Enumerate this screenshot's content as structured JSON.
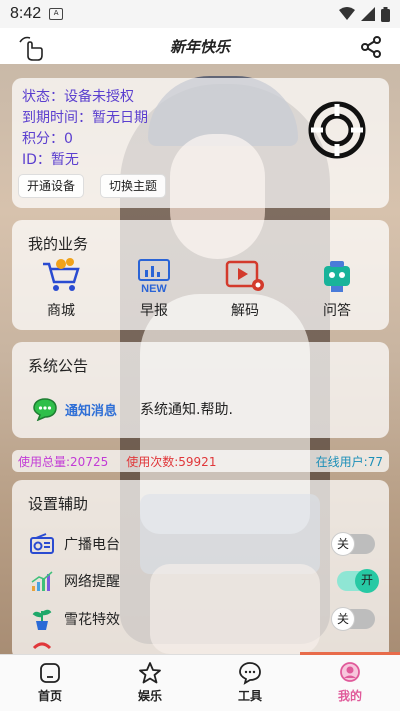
{
  "status_bar": {
    "time": "8:42",
    "notif_badge": "ᴀA"
  },
  "app_bar": {
    "title": "新年快乐"
  },
  "device_card": {
    "status_line": "状态：设备未授权",
    "expiry_line": "到期时间：暂无日期",
    "points_line": "积分：0",
    "id_line": "ID：暂无",
    "activate_button": "开通设备",
    "switch_theme_button": "切换主题"
  },
  "business": {
    "title": "我的业务",
    "items": [
      {
        "label": "商城",
        "icon": "shopping-cart-icon"
      },
      {
        "label": "早报",
        "icon": "news-icon"
      },
      {
        "label": "解码",
        "icon": "video-decode-icon"
      },
      {
        "label": "问答",
        "icon": "robot-icon"
      }
    ]
  },
  "notice": {
    "title": "系统公告",
    "tag": "通知消息",
    "message": "系统通知.帮助."
  },
  "stats": {
    "total_label": "使用总量:",
    "total_value": "20725",
    "count_label": "使用次数:",
    "count_value": "59921",
    "online_label": "在线用户:",
    "online_value": "77"
  },
  "settings": {
    "title": "设置辅助",
    "rows": [
      {
        "label": "广播电台",
        "state": "关",
        "on": false,
        "icon": "radio-icon"
      },
      {
        "label": "网络提醒",
        "state": "开",
        "on": true,
        "icon": "signal-bars-icon"
      },
      {
        "label": "雪花特效",
        "state": "关",
        "on": false,
        "icon": "plant-icon"
      },
      {
        "label": "",
        "state": "",
        "on": false,
        "icon": "partial-icon"
      }
    ]
  },
  "tabs": [
    {
      "label": "首页",
      "icon": "home-icon"
    },
    {
      "label": "娱乐",
      "icon": "star-icon"
    },
    {
      "label": "工具",
      "icon": "chat-bubble-icon"
    },
    {
      "label": "我的",
      "icon": "profile-icon",
      "active": true
    }
  ],
  "colors": {
    "accent": "#5b3fcf",
    "toggle_on": "#27c9a4",
    "active_tab": "#e05a9a"
  }
}
